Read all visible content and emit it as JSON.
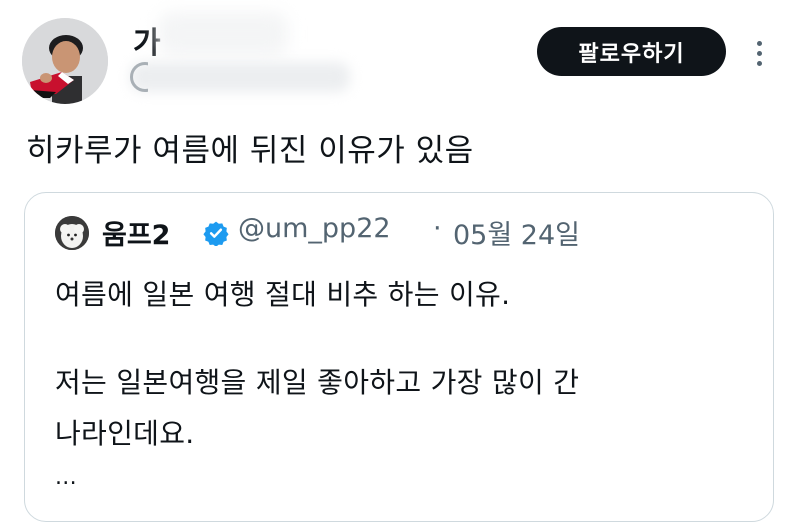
{
  "header": {
    "user_name": "가",
    "follow_label": "팔로우하기",
    "more_icon": "ellipsis-vertical-icon"
  },
  "tweet": {
    "text": "히카루가 여름에 뒤진 이유가 있음"
  },
  "quote": {
    "name": "움프2",
    "verified_color": "#1d9bf0",
    "handle": "@um_pp22",
    "separator": "·",
    "date": "05월 24일",
    "lines": [
      "여름에 일본 여행 절대 비추 하는 이유.",
      "저는 일본여행을 제일 좋아하고 가장 많이 간",
      "나라인데요.",
      "..."
    ]
  }
}
